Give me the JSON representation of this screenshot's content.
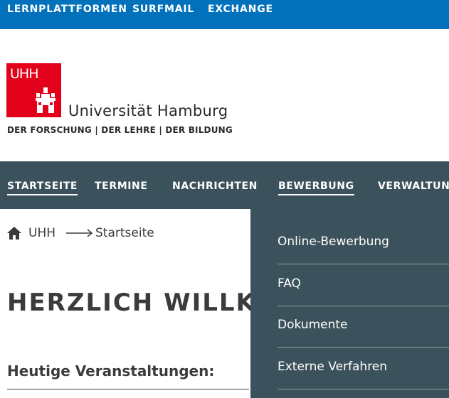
{
  "topbar": {
    "links": [
      "LERNPLATTFORMEN",
      "SURFMAIL",
      "EXCHANGE"
    ]
  },
  "logo": {
    "mark": "UHH",
    "name": "Universität Hamburg",
    "slogan": "DER FORSCHUNG | DER LEHRE | DER BILDUNG",
    "color": "#e2001a"
  },
  "mainnav": {
    "items": [
      "STARTSEITE",
      "TERMINE",
      "NACHRICHTEN",
      "BEWERBUNG",
      "VERWALTUNG"
    ]
  },
  "breadcrumb": {
    "home": "UHH",
    "current": "Startseite"
  },
  "main": {
    "welcome": "HERZLICH WILLKO",
    "events_heading": "Heutige Veranstaltungen:"
  },
  "dropdown": {
    "items": [
      "Online-Bewerbung",
      "FAQ",
      "Dokumente",
      "Externe Verfahren"
    ]
  },
  "colors": {
    "topbar": "#0271bb",
    "nav": "#3b515b"
  }
}
